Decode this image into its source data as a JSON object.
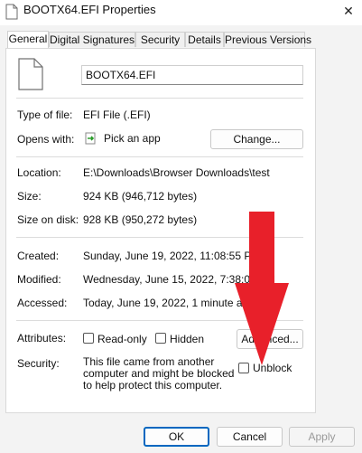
{
  "window": {
    "title": "BOOTX64.EFI Properties",
    "close_glyph": "✕"
  },
  "tabs": [
    {
      "label": "General",
      "active": true
    },
    {
      "label": "Digital Signatures",
      "active": false
    },
    {
      "label": "Security",
      "active": false
    },
    {
      "label": "Details",
      "active": false
    },
    {
      "label": "Previous Versions",
      "active": false
    }
  ],
  "file": {
    "name": "BOOTX64.EFI",
    "icon": "file-icon"
  },
  "details": {
    "type_label": "Type of file:",
    "type_value": "EFI File (.EFI)",
    "opens_label": "Opens with:",
    "opens_value": "Pick an app",
    "opens_icon": "pick-app-icon",
    "change_button": "Change...",
    "location_label": "Location:",
    "location_value": "E:\\Downloads\\Browser Downloads\\test",
    "size_label": "Size:",
    "size_value": "924 KB (946,712 bytes)",
    "size_on_disk_label": "Size on disk:",
    "size_on_disk_value": "928 KB (950,272 bytes)",
    "created_label": "Created:",
    "created_value": "Sunday, June 19, 2022, 11:08:55 PM",
    "modified_label": "Modified:",
    "modified_value": "Wednesday, June 15, 2022, 7:38:06 PM",
    "accessed_label": "Accessed:",
    "accessed_value": "Today, June 19, 2022, 1 minute ago"
  },
  "attributes": {
    "label": "Attributes:",
    "readonly_label": "Read-only",
    "readonly_checked": false,
    "hidden_label": "Hidden",
    "hidden_checked": false,
    "advanced_button": "Advanced..."
  },
  "security": {
    "label": "Security:",
    "text": "This file came from another computer and might be blocked to help protect this computer.",
    "unblock_label": "Unblock",
    "unblock_checked": false
  },
  "buttons": {
    "ok": "OK",
    "cancel": "Cancel",
    "apply": "Apply"
  },
  "colors": {
    "arrow": "#e8202a",
    "ok_border": "#0067c0",
    "window_bg": "#f3f3f3"
  }
}
